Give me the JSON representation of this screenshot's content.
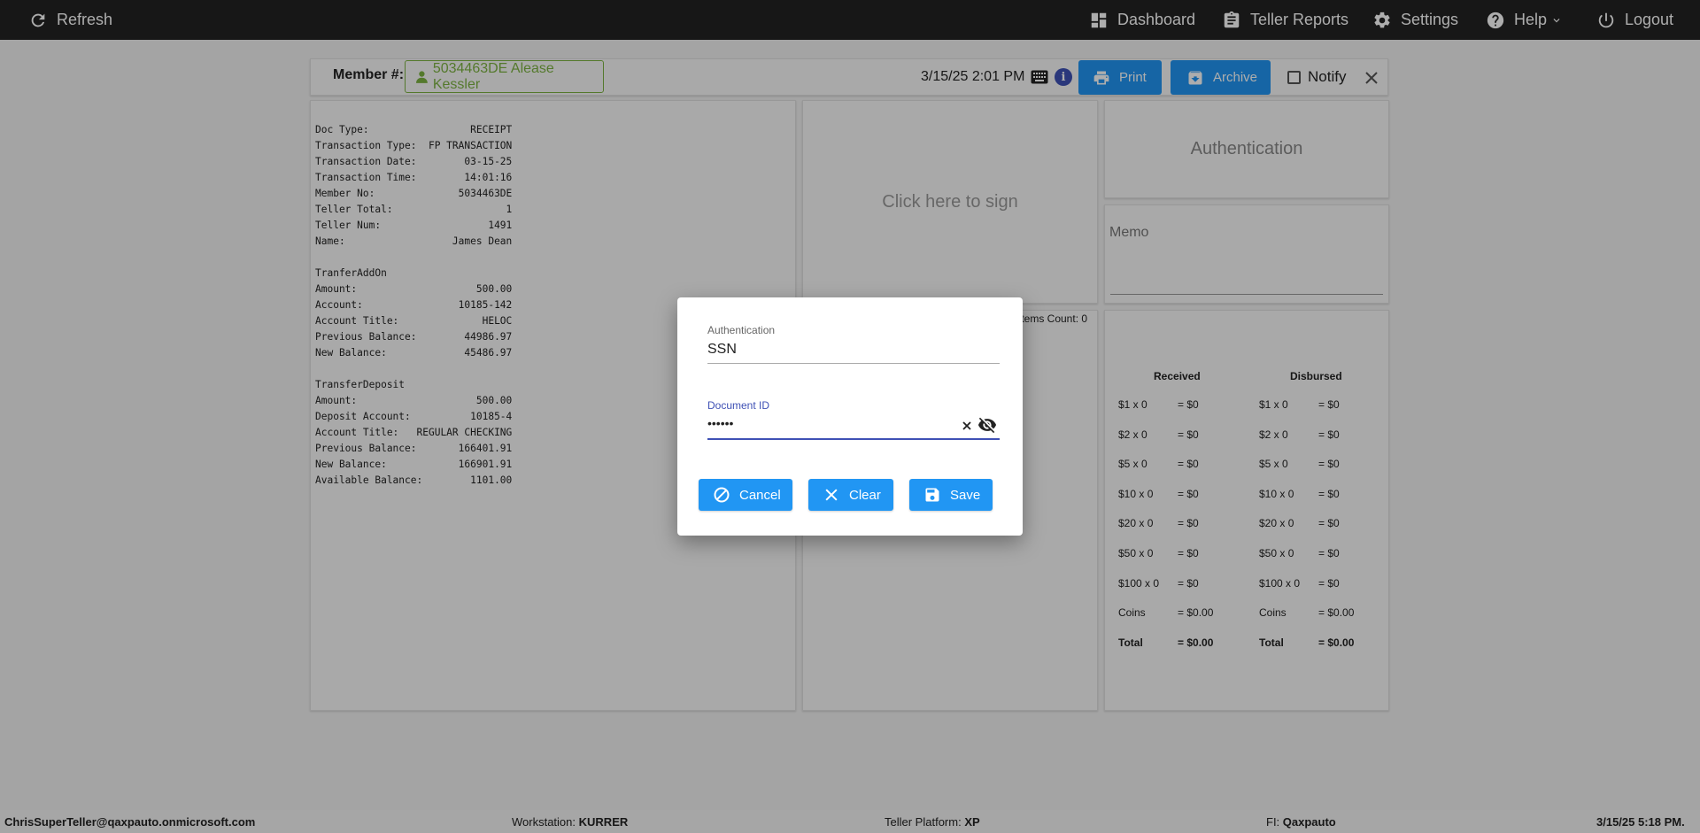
{
  "nav": {
    "refresh": "Refresh",
    "dashboard": "Dashboard",
    "teller_reports": "Teller Reports",
    "settings": "Settings",
    "help": "Help",
    "logout": "Logout"
  },
  "header": {
    "member_label": "Member #:",
    "member_value": "5034463DE Alease Kessler",
    "datetime": "3/15/25 2:01 PM",
    "info": "i",
    "print": "Print",
    "archive": "Archive",
    "notify": "Notify"
  },
  "receipt": {
    "lines": [
      [
        "Doc Type:",
        "RECEIPT"
      ],
      [
        "Transaction Type:",
        "FP TRANSACTION"
      ],
      [
        "Transaction Date:",
        "03-15-25"
      ],
      [
        "Transaction Time:",
        "14:01:16"
      ],
      [
        "Member No:",
        "5034463DE"
      ],
      [
        "Teller Total:",
        "1"
      ],
      [
        "Teller Num:",
        "1491"
      ],
      [
        "Name:",
        "James Dean"
      ],
      [
        "",
        ""
      ],
      [
        "TranferAddOn",
        ""
      ],
      [
        "Amount:",
        "500.00"
      ],
      [
        "Account:",
        "10185-142"
      ],
      [
        "Account Title:",
        "HELOC"
      ],
      [
        "Previous Balance:",
        "44986.97"
      ],
      [
        "New Balance:",
        "45486.97"
      ],
      [
        "",
        ""
      ],
      [
        "TransferDeposit",
        ""
      ],
      [
        "Amount:",
        "500.00"
      ],
      [
        "Deposit Account:",
        "10185-4"
      ],
      [
        "Account Title:",
        "REGULAR CHECKING"
      ],
      [
        "Previous Balance:",
        "166401.91"
      ],
      [
        "New Balance:",
        "166901.91"
      ],
      [
        "Available Balance:",
        "1101.00"
      ]
    ]
  },
  "sign": {
    "prompt": "Click here to sign"
  },
  "items_count": "Items Count: 0",
  "auth_panel": {
    "label": "Authentication"
  },
  "memo": {
    "label": "Memo"
  },
  "cash": {
    "received_header": "Received",
    "disbursed_header": "Disbursed",
    "received": [
      [
        "$1 x 0",
        "= $0"
      ],
      [
        "$2 x 0",
        "= $0"
      ],
      [
        "$5 x 0",
        "= $0"
      ],
      [
        "$10 x 0",
        "= $0"
      ],
      [
        "$20 x 0",
        "= $0"
      ],
      [
        "$50 x 0",
        "= $0"
      ],
      [
        "$100 x 0",
        "= $0"
      ],
      [
        "Coins",
        "= $0.00"
      ],
      [
        "Total",
        "= $0.00"
      ]
    ],
    "disbursed": [
      [
        "$1 x 0",
        "= $0"
      ],
      [
        "$2 x 0",
        "= $0"
      ],
      [
        "$5 x 0",
        "= $0"
      ],
      [
        "$10 x 0",
        "= $0"
      ],
      [
        "$20 x 0",
        "= $0"
      ],
      [
        "$50 x 0",
        "= $0"
      ],
      [
        "$100 x 0",
        "= $0"
      ],
      [
        "Coins",
        "= $0.00"
      ],
      [
        "Total",
        "= $0.00"
      ]
    ]
  },
  "modal": {
    "auth_label": "Authentication",
    "auth_value": "SSN",
    "doc_label": "Document ID",
    "doc_value": "••••••",
    "cancel": "Cancel",
    "clear": "Clear",
    "save": "Save",
    "accent_color": "#3f51b5",
    "button_color": "#2196f3"
  },
  "status": {
    "user": "ChrisSuperTeller@qaxpauto.onmicrosoft.com",
    "workstation_label": "Workstation:",
    "workstation_value": "KURRER",
    "platform_label": "Teller Platform:",
    "platform_value": "XP",
    "fi_label": "FI:",
    "fi_value": "Qaxpauto",
    "datetime": "3/15/25 5:18 PM."
  }
}
